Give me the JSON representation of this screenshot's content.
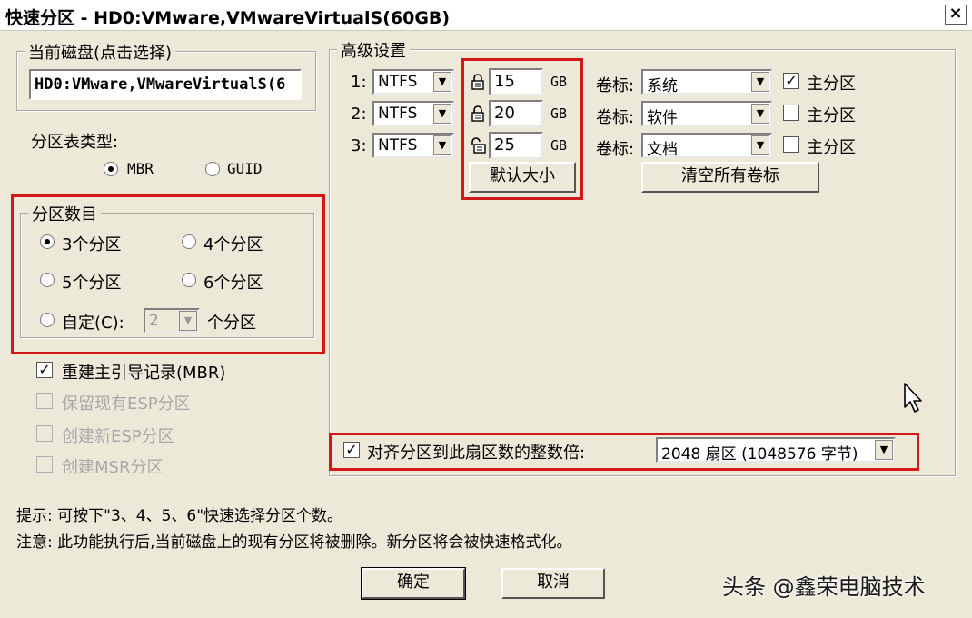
{
  "window": {
    "title": "快速分区 - HD0:VMware,VMwareVirtualS(60GB)",
    "close": "×"
  },
  "current_disk": {
    "legend": "当前磁盘(点击选择)",
    "value": "HD0:VMware,VMwareVirtualS(6"
  },
  "partition_table": {
    "label": "分区表类型:",
    "options": [
      "MBR",
      "GUID"
    ],
    "selected": "MBR"
  },
  "partition_count": {
    "legend": "分区数目",
    "options": [
      "3个分区",
      "4个分区",
      "5个分区",
      "6个分区"
    ],
    "selected": "3个分区",
    "custom_label": "自定(C):",
    "custom_value": "2",
    "custom_suffix": "个分区"
  },
  "options": [
    {
      "label": "重建主引导记录(MBR)",
      "checked": true,
      "disabled": false
    },
    {
      "label": "保留现有ESP分区",
      "checked": false,
      "disabled": true
    },
    {
      "label": "创建新ESP分区",
      "checked": false,
      "disabled": true
    },
    {
      "label": "创建MSR分区",
      "checked": false,
      "disabled": true
    }
  ],
  "advanced": {
    "legend": "高级设置",
    "rows": [
      {
        "index": "1:",
        "fs": "NTFS",
        "size": "15",
        "unit": "GB",
        "volume_label": "卷标:",
        "volume": "系统",
        "primary_label": "主分区",
        "primary": true,
        "lock": "locked"
      },
      {
        "index": "2:",
        "fs": "NTFS",
        "size": "20",
        "unit": "GB",
        "volume_label": "卷标:",
        "volume": "软件",
        "primary_label": "主分区",
        "primary": false,
        "lock": "locked"
      },
      {
        "index": "3:",
        "fs": "NTFS",
        "size": "25",
        "unit": "GB",
        "volume_label": "卷标:",
        "volume": "文档",
        "primary_label": "主分区",
        "primary": false,
        "lock": "unlocked"
      }
    ],
    "default_size_button": "默认大小",
    "clear_labels_button": "清空所有卷标",
    "align_label": "对齐分区到此扇区数的整数倍:",
    "align_checked": true,
    "align_value": "2048 扇区 (1048576 字节)"
  },
  "hints": {
    "tip": "提示: 可按下\"3、4、5、6\"快速选择分区个数。",
    "note": "注意: 此功能执行后,当前磁盘上的现有分区将被删除。新分区将会被快速格式化。"
  },
  "buttons": {
    "ok": "确定",
    "cancel": "取消"
  },
  "watermark": "头条 @鑫荣电脑技术",
  "colors": {
    "highlight_red": "#d01818",
    "dialog_bg": "#ece9d8"
  }
}
